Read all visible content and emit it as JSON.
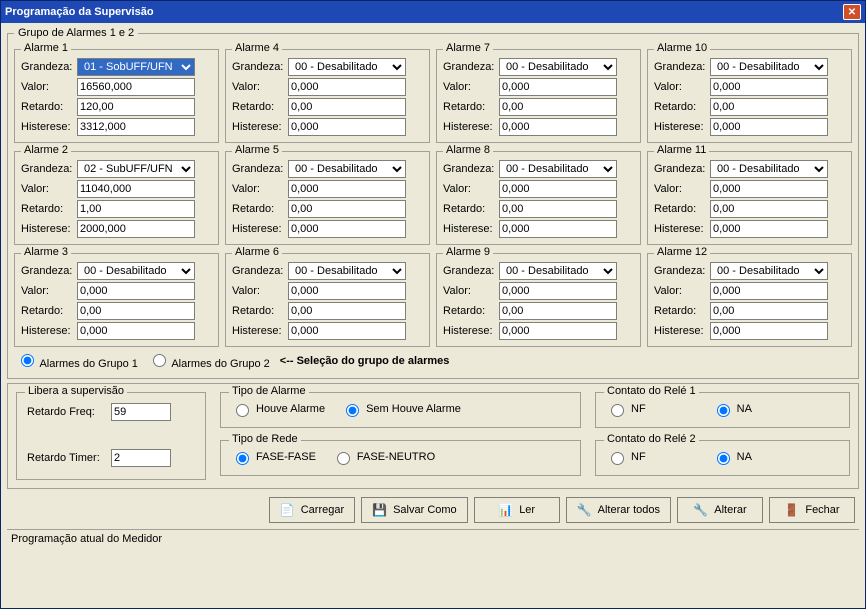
{
  "window": {
    "title": "Programação da Supervisão"
  },
  "group_box_title": "Grupo de Alarmes 1 e 2",
  "labels": {
    "grandeza": "Grandeza:",
    "valor": "Valor:",
    "retardo": "Retardo:",
    "histerese": "Histerese:"
  },
  "alarms": [
    {
      "title": "Alarme 1",
      "grandeza": "01 - SobUFF/UFN",
      "valor": "16560,000",
      "retardo": "120,00",
      "histerese": "3312,000",
      "highlight": true
    },
    {
      "title": "Alarme 2",
      "grandeza": "02 - SubUFF/UFN",
      "valor": "11040,000",
      "retardo": "1,00",
      "histerese": "2000,000"
    },
    {
      "title": "Alarme 3",
      "grandeza": "00 - Desabilitado",
      "valor": "0,000",
      "retardo": "0,00",
      "histerese": "0,000"
    },
    {
      "title": "Alarme 4",
      "grandeza": "00 - Desabilitado",
      "valor": "0,000",
      "retardo": "0,00",
      "histerese": "0,000"
    },
    {
      "title": "Alarme 5",
      "grandeza": "00 - Desabilitado",
      "valor": "0,000",
      "retardo": "0,00",
      "histerese": "0,000"
    },
    {
      "title": "Alarme 6",
      "grandeza": "00 - Desabilitado",
      "valor": "0,000",
      "retardo": "0,00",
      "histerese": "0,000"
    },
    {
      "title": "Alarme 7",
      "grandeza": "00 - Desabilitado",
      "valor": "0,000",
      "retardo": "0,00",
      "histerese": "0,000"
    },
    {
      "title": "Alarme 8",
      "grandeza": "00 - Desabilitado",
      "valor": "0,000",
      "retardo": "0,00",
      "histerese": "0,000"
    },
    {
      "title": "Alarme 9",
      "grandeza": "00 - Desabilitado",
      "valor": "0,000",
      "retardo": "0,00",
      "histerese": "0,000"
    },
    {
      "title": "Alarme 10",
      "grandeza": "00 - Desabilitado",
      "valor": "0,000",
      "retardo": "0,00",
      "histerese": "0,000"
    },
    {
      "title": "Alarme 11",
      "grandeza": "00 - Desabilitado",
      "valor": "0,000",
      "retardo": "0,00",
      "histerese": "0,000"
    },
    {
      "title": "Alarme 12",
      "grandeza": "00 - Desabilitado",
      "valor": "0,000",
      "retardo": "0,00",
      "histerese": "0,000"
    }
  ],
  "group_select": {
    "g1": "Alarmes do Grupo 1",
    "g2": "Alarmes do Grupo 2",
    "hint": "<-- Seleção do grupo de alarmes",
    "selected": "g1"
  },
  "libera": {
    "title": "Libera a supervisão",
    "retardo_freq_label": "Retardo Freq:",
    "retardo_freq": "59",
    "retardo_timer_label": "Retardo Timer:",
    "retardo_timer": "2"
  },
  "tipo_alarme": {
    "title": "Tipo de Alarme",
    "opt1": "Houve Alarme",
    "opt2": "Sem Houve Alarme",
    "selected": "opt2"
  },
  "tipo_rede": {
    "title": "Tipo de Rede",
    "opt1": "FASE-FASE",
    "opt2": "FASE-NEUTRO",
    "selected": "opt1"
  },
  "rele1": {
    "title": "Contato do Relé 1",
    "opt1": "NF",
    "opt2": "NA",
    "selected": "opt2"
  },
  "rele2": {
    "title": "Contato do Relé 2",
    "opt1": "NF",
    "opt2": "NA",
    "selected": "opt2"
  },
  "buttons": {
    "carregar": "Carregar",
    "salvar": "Salvar Como",
    "ler": "Ler",
    "alterar_todos": "Alterar todos",
    "alterar": "Alterar",
    "fechar": "Fechar"
  },
  "status": "Programação atual do Medidor",
  "icons": {
    "carregar": "📄",
    "salvar": "💾",
    "ler": "📊",
    "alterar_todos": "🔧",
    "alterar": "🔧",
    "fechar": "🚪"
  }
}
